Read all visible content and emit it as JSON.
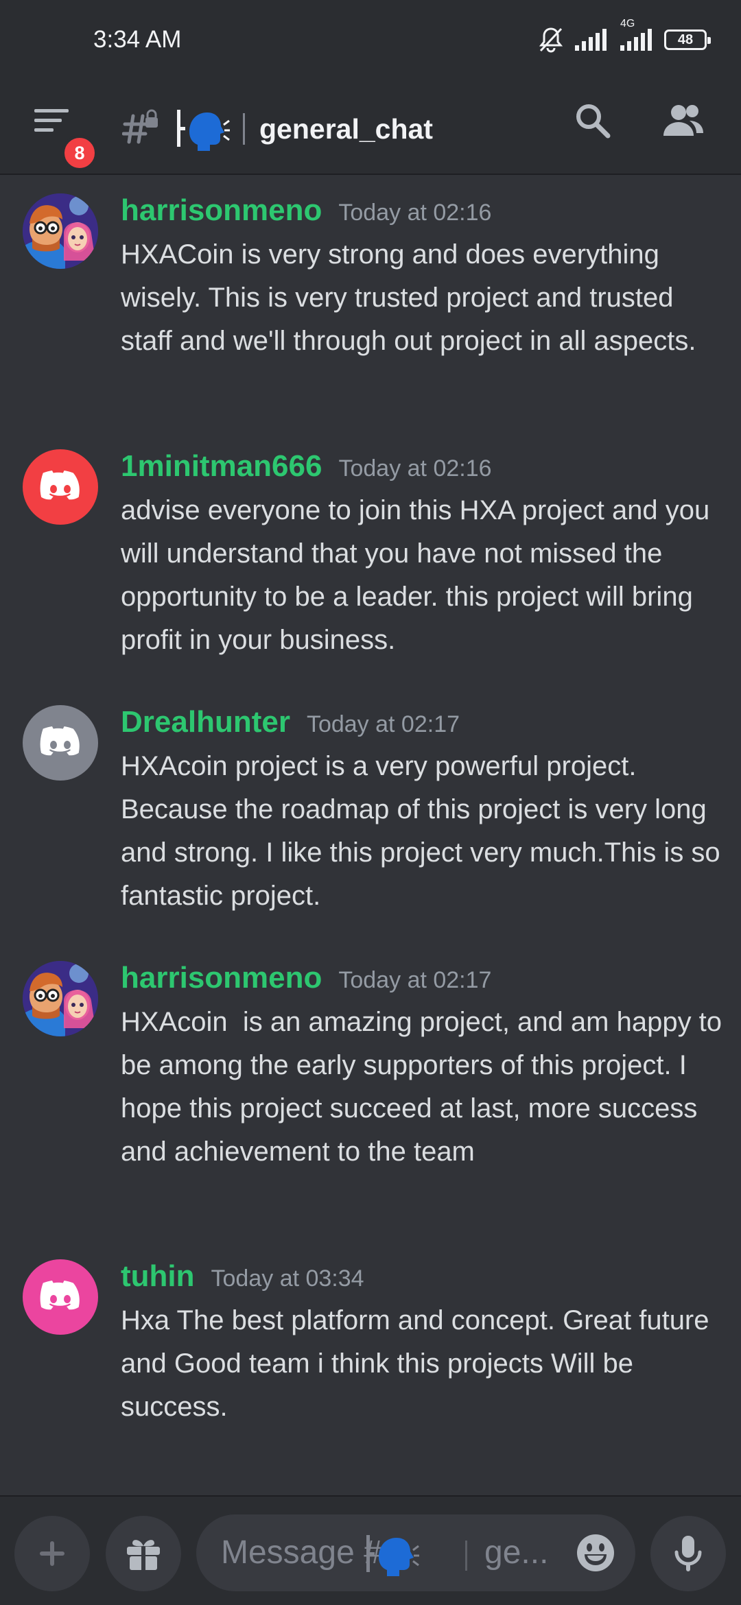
{
  "status_bar": {
    "time": "3:34 AM",
    "network": "4G",
    "battery": "48"
  },
  "header": {
    "notification_count": "8",
    "channel_name": "general_chat"
  },
  "messages": [
    {
      "username": "harrisonmeno",
      "timestamp": "Today at 02:16",
      "avatar": "cartoon-couple",
      "text": "HXACoin is very strong and does everything wisely. This is very trusted project and trusted staff and we'll through out project in all aspects."
    },
    {
      "username": "1minitman666",
      "timestamp": "Today at 02:16",
      "avatar": "discord-red",
      "text": "advise everyone to join this HXA project and you will understand that you have not missed the opportunity to be a leader. this project will bring profit in your business."
    },
    {
      "username": "Drealhunter",
      "timestamp": "Today at 02:17",
      "avatar": "discord-grey",
      "text": "HXAcoin project is a very powerful project. Because the roadmap of this project is very long and strong. I like this project very much.This is so fantastic project."
    },
    {
      "username": "harrisonmeno",
      "timestamp": "Today at 02:17",
      "avatar": "cartoon-couple",
      "text": "HXAcoin  is an amazing project, and am happy to be among the early supporters of this project. I hope this project succeed at last, more success and achievement to the team"
    },
    {
      "username": "tuhin",
      "timestamp": "Today at 03:34",
      "avatar": "discord-pink",
      "text": "Hxa The best platform and concept. Great future and Good team i think this projects Will be success."
    }
  ],
  "composer": {
    "placeholder_prefix": "Message #",
    "placeholder_suffix": "ge..."
  },
  "colors": {
    "username": "#2dc770",
    "discord_red": "#f23f43",
    "discord_grey": "#80848e",
    "discord_pink": "#eb459f",
    "background": "#313338"
  }
}
